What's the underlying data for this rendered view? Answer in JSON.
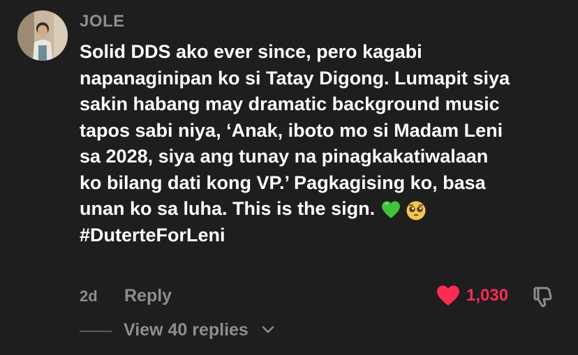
{
  "comment": {
    "username": "JOLE",
    "text": "Solid DDS ako ever since, pero kagabi\nnapanaginipan ko si Tatay Digong. Lumapit siya\nsakin habang may dramatic background music\ntapos sabi niya, ‘Anak, iboto mo si Madam Leni\nsa 2028, siya ang tunay na pinagkakatiwalaan\nko bilang dati kong VP.’ Pagkagising ko, basa\nunan ko sa luha. This is the sign.",
    "hashtag": "#DuterteForLeni",
    "emojis": [
      "green-heart-emoji",
      "pleading-face-emoji"
    ],
    "age": "2d",
    "reply_label": "Reply",
    "like_count": "1,030",
    "view_replies_label": "View 40 replies"
  },
  "colors": {
    "background": "#1e1e1e",
    "text": "#ffffff",
    "muted": "#8d8d8d",
    "like": "#fe2c55"
  },
  "icons": {
    "like": "heart-icon",
    "dislike": "thumbs-down-icon",
    "expand": "chevron-down-icon"
  }
}
